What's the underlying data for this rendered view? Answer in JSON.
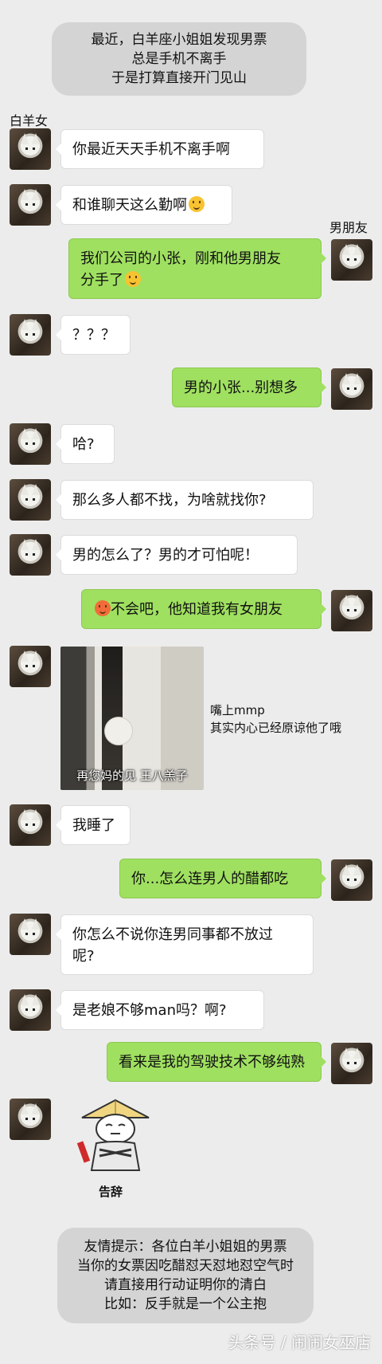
{
  "intro_lines": [
    "最近，白羊座小姐姐发现男票",
    "总是手机不离手",
    "于是打算直接开门见山"
  ],
  "left_name": "白羊女",
  "right_name": "男朋友",
  "messages": {
    "m1": "你最近天天手机不离手啊",
    "m2": "和谁聊天这么勤啊",
    "m3_line1": "我们公司的小张，刚和他男朋友",
    "m3_line2": "分手了",
    "m4": "？？？",
    "m5": "男的小张...别想多",
    "m6": "哈?",
    "m7": "那么多人都不找，为啥就找你?",
    "m8": "男的怎么了？男的才可怕呢！",
    "m9": "不会吧，他知道我有女朋友",
    "m10": "我睡了",
    "m11": "你...怎么连男人的醋都吃",
    "m12_line1": "你怎么不说你连男同事都不放过",
    "m12_line2": "呢?",
    "m13": "是老娘不够man吗？啊?",
    "m14": "看来是我的驾驶技术不够纯熟"
  },
  "photo_caption": "再您妈的见 王八羔子",
  "side_note_lines": [
    "嘴上mmp",
    "其实内心已经原谅他了哦"
  ],
  "sticker_label": "告辞",
  "tips_lines": [
    "友情提示：各位白羊小姐姐的男票",
    "当你的女票因吃醋怼天怼地怼空气时",
    "请直接用行动证明你的清白",
    "比如：反手就是一个公主抱"
  ],
  "footer": "头条号 / 闹闹女巫店",
  "icons": {
    "emoji_smile": "smile-emoji",
    "emoji_cry": "cry-laugh-emoji",
    "emoji_angry": "angry-emoji"
  }
}
